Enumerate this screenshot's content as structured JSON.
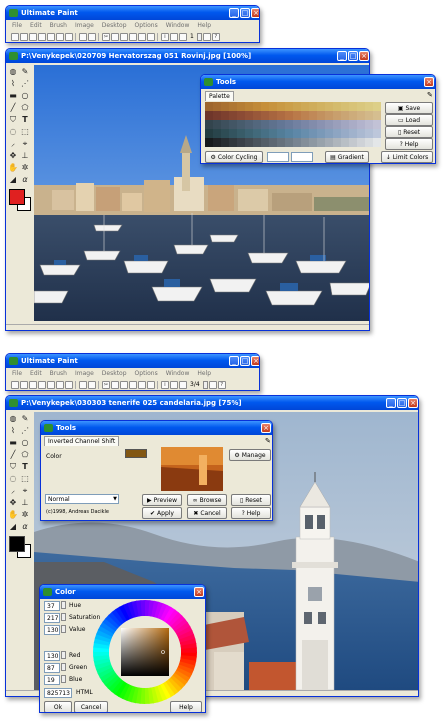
{
  "app": {
    "title": "Ultimate Paint",
    "menu": [
      "File",
      "Edit",
      "Brush",
      "Image",
      "Desktop",
      "Options",
      "Window",
      "Help"
    ],
    "page_counter_top": "1",
    "page_counter_bottom": "3/4"
  },
  "shot1": {
    "doc_title": "P:\\Venykepek\\020709 Hervatorszag 051 Rovinj.jpg [100%]",
    "tools": {
      "title": "Tools",
      "tab": "Palette",
      "buttons": {
        "save": "Save",
        "load": "Load",
        "reset": "Reset",
        "help": "Help"
      },
      "bottom": {
        "cycling": "Color Cycling",
        "gradient": "Gradient",
        "limit": "Limit Colors"
      }
    },
    "colors": {
      "primary": "#e02020",
      "secondary": "#ffffff"
    }
  },
  "shot2": {
    "doc_title": "P:\\Venykepek\\030303 tenerife 025 candelaria.jpg [75%]",
    "tools": {
      "title": "Tools",
      "tab": "Inverted Channel Shift",
      "color_label": "Color",
      "manage": "Manage",
      "mode_value": "Normal",
      "copyright": "(c)1998, Andreas Dacikle",
      "buttons": {
        "preview": "Preview",
        "browse": "Browse",
        "reset": "Reset",
        "apply": "Apply",
        "cancel": "Cancel",
        "help": "Help"
      }
    },
    "color_dialog": {
      "title": "Color",
      "fields": {
        "hue": {
          "value": "37",
          "label": "Hue"
        },
        "saturation": {
          "value": "217",
          "label": "Saturation"
        },
        "value": {
          "value": "130",
          "label": "Value"
        },
        "red": {
          "value": "130",
          "label": "Red"
        },
        "green": {
          "value": "87",
          "label": "Green"
        },
        "blue": {
          "value": "19",
          "label": "Blue"
        },
        "html": {
          "value": "825713",
          "label": "HTML"
        }
      },
      "buttons": {
        "ok": "Ok",
        "cancel": "Cancel",
        "help": "Help"
      }
    },
    "colors": {
      "primary": "#000000",
      "secondary": "#ffffff",
      "swatch": "#825713"
    }
  },
  "icons": [
    "paint-bucket",
    "pencil",
    "brush",
    "rectangle",
    "ellipse",
    "text",
    "move",
    "zoom",
    "eraser",
    "eyedropper"
  ]
}
